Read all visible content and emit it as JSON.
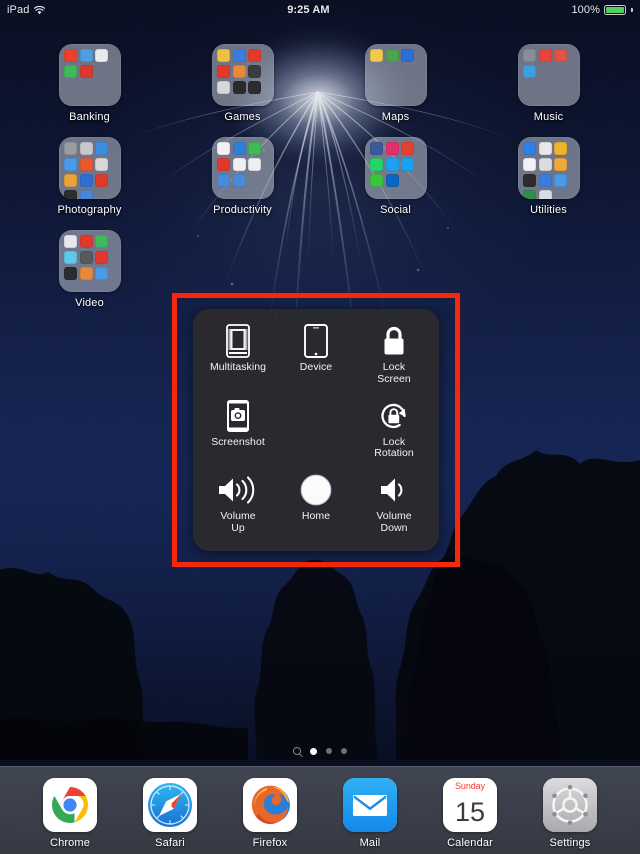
{
  "statusbar": {
    "device_label": "iPad",
    "wifi_icon": "wifi-icon",
    "time": "9:25 AM",
    "battery_percent": "100%",
    "battery_color": "#52d05a"
  },
  "home_screen": {
    "rows": [
      [
        {
          "name": "Banking",
          "icon_count": 5
        },
        {
          "name": "Games",
          "icon_count": 9
        },
        {
          "name": "Maps",
          "icon_count": 3
        },
        {
          "name": "Music",
          "icon_count": 4
        }
      ],
      [
        {
          "name": "Photography",
          "icon_count": 11
        },
        {
          "name": "Productivity",
          "icon_count": 8
        },
        {
          "name": "Social",
          "icon_count": 8
        },
        {
          "name": "Utilities",
          "icon_count": 11
        }
      ],
      [
        {
          "name": "Video",
          "icon_count": 9
        }
      ]
    ],
    "folder_colors": {
      "Banking": [
        "#e8412e",
        "#4f9fe0",
        "#e9eaec",
        "#3fb95a",
        "#d93a2b"
      ],
      "Games": [
        "#f0c040",
        "#3b7ddd",
        "#e23b2e",
        "#e0392c",
        "#e8893a",
        "#3c3c3c",
        "#d8d8d8",
        "#2b2b2b",
        "#2c2c2c",
        "#e03a2c",
        "#3777d8"
      ],
      "Maps": [
        "#f0c84a",
        "#4fa24f",
        "#2b6fd6"
      ],
      "Music": [
        "#8c8c94",
        "#e8463a",
        "#e0524a",
        "#3aa0e0"
      ],
      "Photography": [
        "#9a9aa2",
        "#c8c8cc",
        "#3b8fe0",
        "#4a9ae6",
        "#e85a2e",
        "#d8d8dc",
        "#e8a33a",
        "#2f6fd0",
        "#e03a2c",
        "#2c2c2c",
        "#4a86d8"
      ],
      "Productivity": [
        "#f2f2f4",
        "#2f7fd8",
        "#3fb95a",
        "#e03a2c",
        "#f0f0f2",
        "#eeeef0",
        "#4a8ad8",
        "#4a8ad8"
      ],
      "Social": [
        "#3b5998",
        "#e1306c",
        "#e8402f",
        "#25d366",
        "#1da1f2",
        "#1da1f2",
        "#3cc23c",
        "#0a66c2"
      ],
      "Utilities": [
        "#2f80e8",
        "#e8e8ea",
        "#f0b32e",
        "#f2f2f4",
        "#dcdce0",
        "#f0a83a",
        "#2c2c2c",
        "#3b7ddd",
        "#4a9ae6",
        "#2f8f4a",
        "#d8dce4"
      ],
      "Video": [
        "#e8e8ea",
        "#e03a2c",
        "#3fb95a",
        "#5fc8e8",
        "#58585e",
        "#e03a2c",
        "#2c2c2c",
        "#e8893a",
        "#4a9ae6"
      ]
    }
  },
  "page_indicator": {
    "search_icon": "search-icon",
    "total_pages": 3,
    "active_page": 1
  },
  "dock": {
    "items": [
      {
        "name": "Chrome",
        "icon": "chrome-icon"
      },
      {
        "name": "Safari",
        "icon": "safari-icon"
      },
      {
        "name": "Firefox",
        "icon": "firefox-icon"
      },
      {
        "name": "Mail",
        "icon": "mail-icon"
      },
      {
        "name": "Calendar",
        "icon": "calendar-icon",
        "weekday": "Sunday",
        "day": "15"
      },
      {
        "name": "Settings",
        "icon": "settings-gear-icon"
      }
    ]
  },
  "assistive_touch": {
    "highlight_color": "#f5270c",
    "panel_bg": "#2a2a2e",
    "items": [
      {
        "label": "Multitasking",
        "icon": "multitasking-icon"
      },
      {
        "label": "Device",
        "icon": "device-icon"
      },
      {
        "label": "Lock\nScreen",
        "label_line1": "Lock",
        "label_line2": "Screen",
        "icon": "lock-icon"
      },
      {
        "label": "Screenshot",
        "icon": "screenshot-camera-icon"
      },
      {
        "label": "",
        "icon": ""
      },
      {
        "label": "Lock\nRotation",
        "label_line1": "Lock",
        "label_line2": "Rotation",
        "icon": "lock-rotation-icon"
      },
      {
        "label": "Volume\nUp",
        "label_line1": "Volume",
        "label_line2": "Up",
        "icon": "volume-up-icon"
      },
      {
        "label": "Home",
        "icon": "home-circle-icon"
      },
      {
        "label": "Volume\nDown",
        "label_line1": "Volume",
        "label_line2": "Down",
        "icon": "volume-down-icon"
      }
    ]
  }
}
